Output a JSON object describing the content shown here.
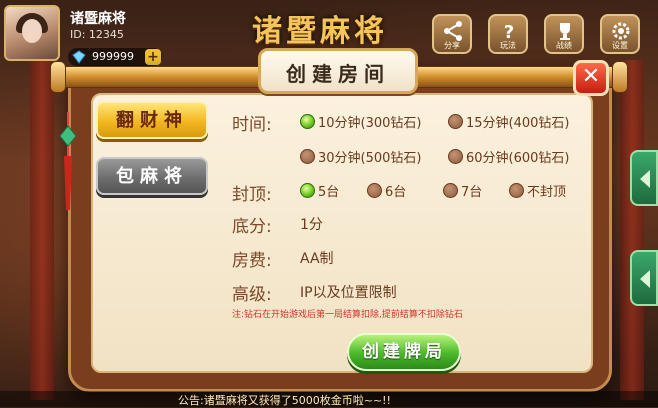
{
  "player": {
    "name": "诸暨麻将",
    "id_text": "ID: 12345",
    "diamonds": "999999",
    "add_symbol": "+"
  },
  "header": {
    "game_title": "诸暨麻将",
    "buttons": [
      {
        "label": "分享",
        "icon": "share-icon"
      },
      {
        "label": "玩法",
        "icon": "help-icon"
      },
      {
        "label": "战绩",
        "icon": "trophy-icon"
      },
      {
        "label": "设置",
        "icon": "gear-icon"
      }
    ]
  },
  "dialog": {
    "title": "创建房间",
    "close_symbol": "✕",
    "modes": [
      {
        "label": "翻财神",
        "selected": true
      },
      {
        "label": "包麻将",
        "selected": false
      }
    ],
    "time": {
      "label": "时间:",
      "options": [
        {
          "label": "10分钟(300钻石)",
          "selected": true
        },
        {
          "label": "15分钟(400钻石)",
          "selected": false
        },
        {
          "label": "30分钟(500钻石)",
          "selected": false
        },
        {
          "label": "60分钟(600钻石)",
          "selected": false
        }
      ]
    },
    "cap": {
      "label": "封顶:",
      "options": [
        {
          "label": "5台",
          "selected": true
        },
        {
          "label": "6台",
          "selected": false
        },
        {
          "label": "7台",
          "selected": false
        },
        {
          "label": "不封顶",
          "selected": false
        }
      ]
    },
    "base": {
      "label": "底分:",
      "value": "1分"
    },
    "fee": {
      "label": "房费:",
      "value": "AA制"
    },
    "advanced": {
      "label": "高级:",
      "value": "IP以及位置限制"
    },
    "note": "注:钻石在开始游戏后第一局结算扣除,提前结算不扣除钻石",
    "create_button": "创建牌局"
  },
  "announcement": "公告:诸暨麻将又获得了5000枚金币啦~~!!",
  "colors": {
    "accent_gold": "#f2b820",
    "selected_green": "#66c21a",
    "note_red": "#d2332a",
    "dialog_brown": "#7a3e1e"
  }
}
